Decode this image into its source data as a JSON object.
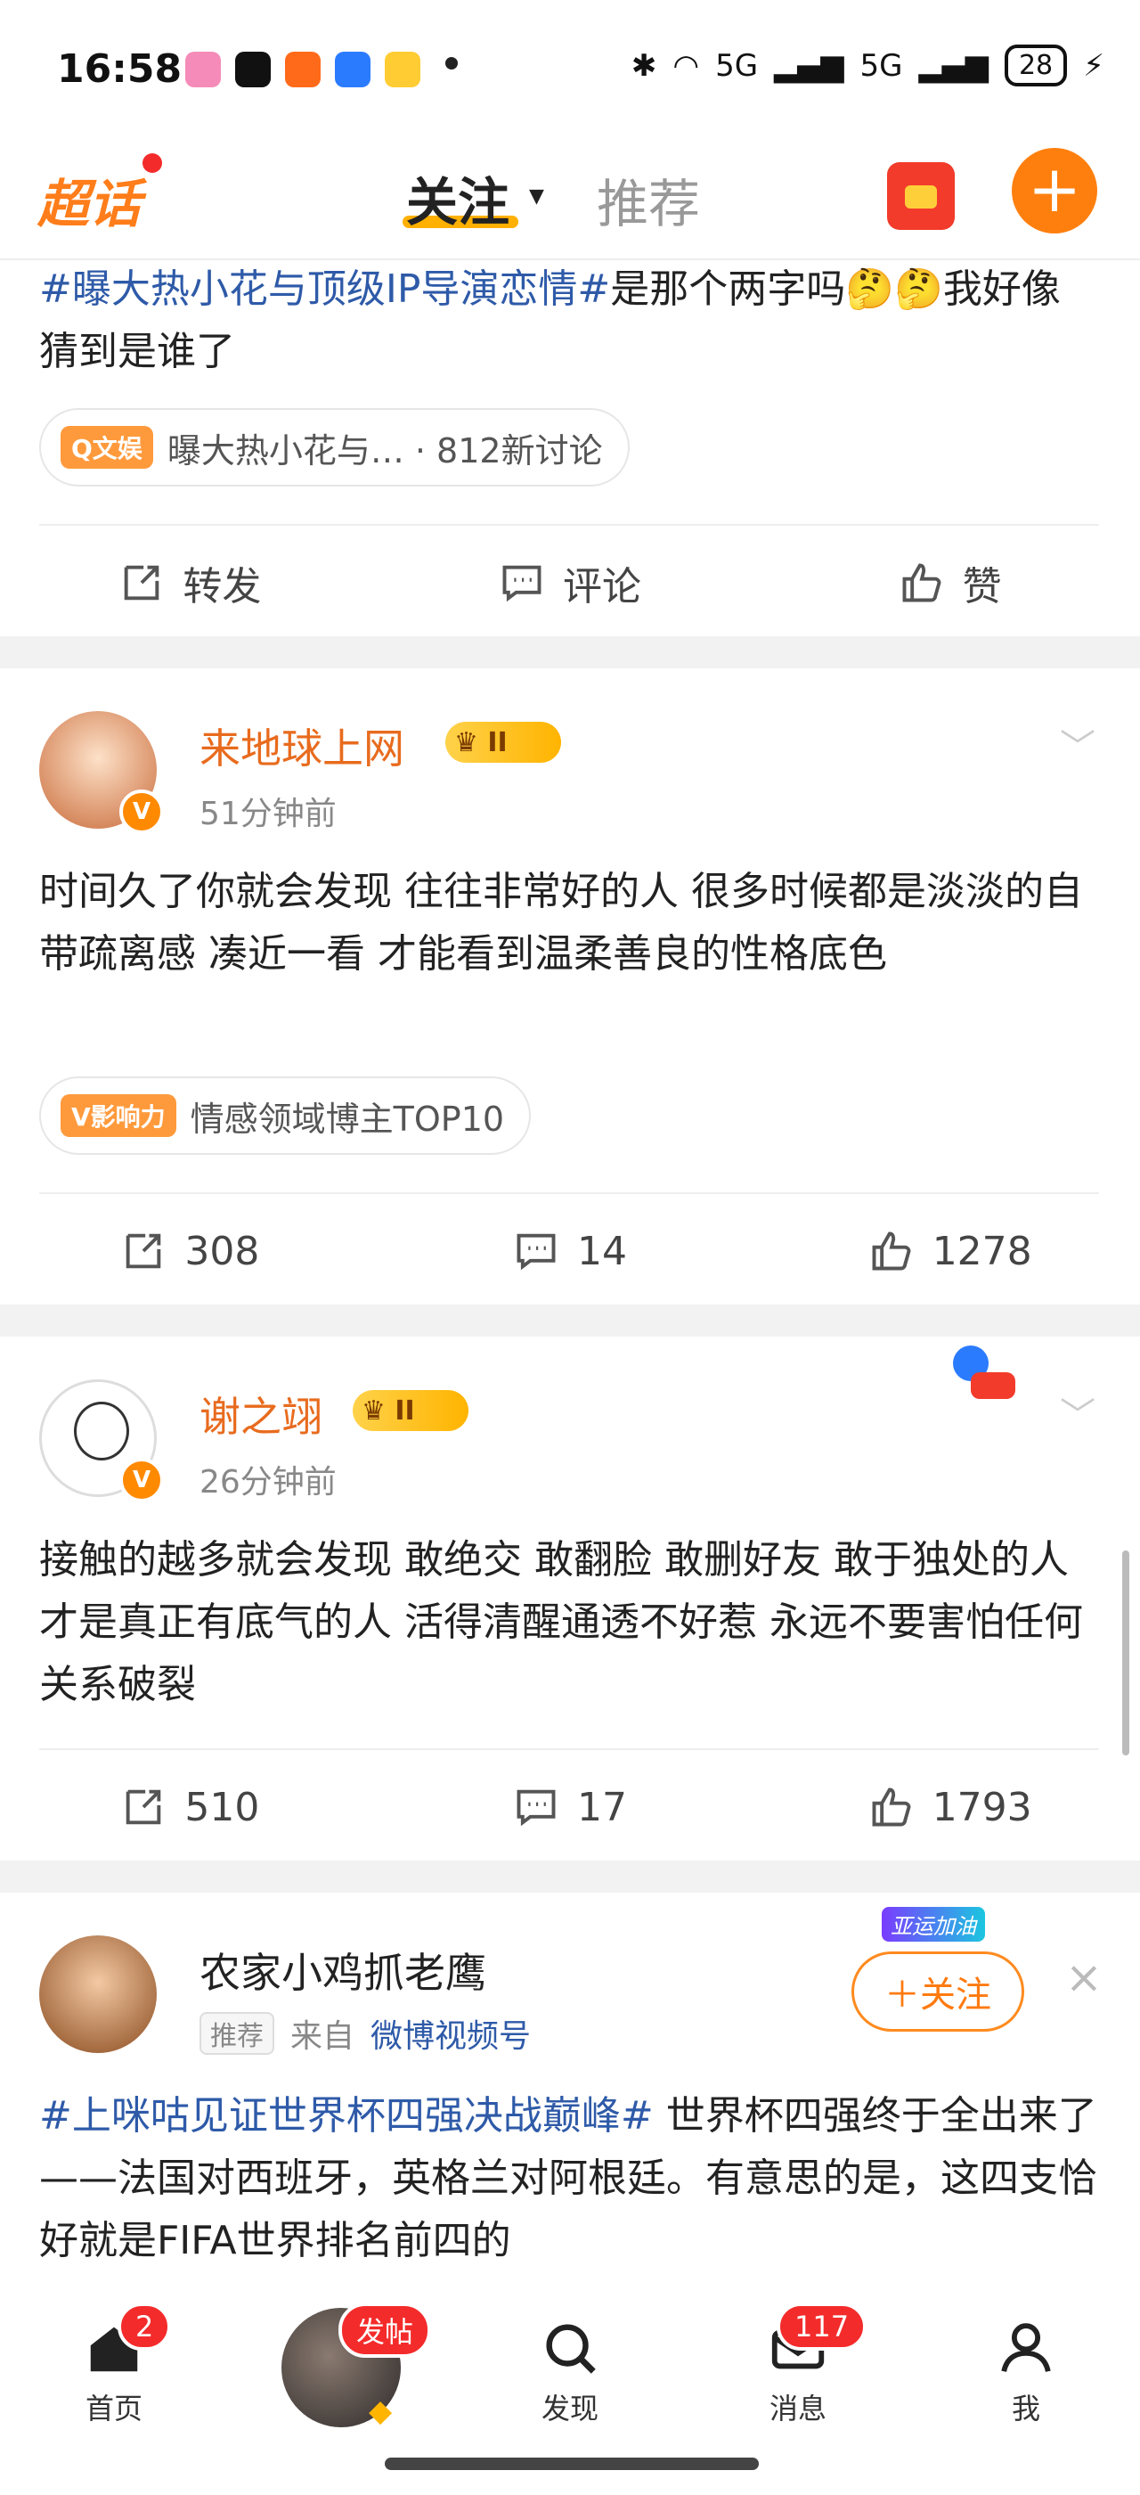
{
  "status_bar": {
    "time": "16:58",
    "signal1": "5G",
    "signal2": "5G",
    "battery": "28"
  },
  "header": {
    "logo": "超话",
    "tab_follow": "关注",
    "tab_recommend": "推荐",
    "plus": "+"
  },
  "post0": {
    "topic": "#曝大热小花与顶级IP导演恋情#",
    "text": "是那个两字吗🤔🤔我好像猜到是谁了",
    "chip_tag": "Q文娱",
    "chip_text": "曝大热小花与… · 812新讨论",
    "repost": "转发",
    "comment": "评论",
    "like": "赞"
  },
  "post1": {
    "user": "来地球上网",
    "level": "II",
    "time": "51分钟前",
    "text": "时间久了你就会发现 往往非常好的人 很多时候都是淡淡的自带疏离感 凑近一看 才能看到温柔善良的性格底色",
    "chip_tag": "V影响力",
    "chip_text": "情感领域博主TOP10",
    "repost": "308",
    "comment": "14",
    "like": "1278"
  },
  "post2": {
    "user": "谢之翊",
    "level": "II",
    "time": "26分钟前",
    "text": "接触的越多就会发现 敢绝交 敢翻脸 敢删好友 敢于独处的人 才是真正有底气的人 活得清醒通透不好惹 永远不要害怕任何关系破裂",
    "repost": "510",
    "comment": "17",
    "like": "1793"
  },
  "post3": {
    "user": "农家小鸡抓老鹰",
    "tag": "推荐",
    "source_prefix": "来自",
    "source": "微博视频号",
    "follow": "＋关注",
    "banner": "亚运加油",
    "topic": "#上咪咕见证世界杯四强决战巅峰#",
    "text": " 世界杯四强终于全出来了——法国对西班牙，英格兰对阿根廷。有意思的是，这四支恰好就是FIFA世界排名前四的"
  },
  "nav": {
    "home": "首页",
    "home_badge": "2",
    "post": "发帖",
    "discover": "发现",
    "messages": "消息",
    "msg_badge": "117",
    "me": "我"
  },
  "colors": {
    "accent": "#ff7f0e",
    "topic": "#2e5aa8",
    "username": "#e86b1e",
    "badge_red": "#f42b2b"
  }
}
